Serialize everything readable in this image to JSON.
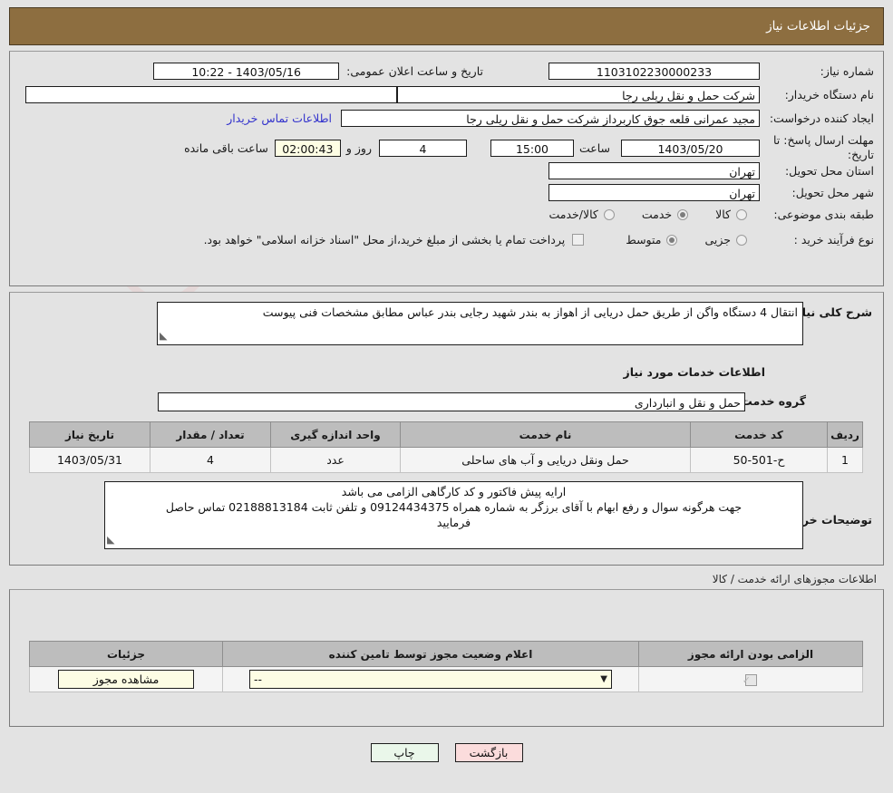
{
  "header": {
    "title": "جزئیات اطلاعات نیاز"
  },
  "top": {
    "need_number_label": "شماره نیاز:",
    "need_number_value": "1103102230000233",
    "public_announce_label": "تاریخ و ساعت اعلان عمومی:",
    "public_announce_value": "1403/05/16 - 10:22",
    "buyer_org_label": "نام دستگاه خریدار:",
    "buyer_org_value": "شرکت حمل و نقل ریلی رجا",
    "buyer_org_extra_value": "",
    "requester_label": "ایجاد کننده درخواست:",
    "requester_value": "مجید عمرانی قلعه جوق کاربرداز شرکت حمل و نقل ریلی رجا",
    "contact_link": "اطلاعات تماس خریدار",
    "deadline_label": "مهلت ارسال پاسخ: تا تاریخ:",
    "deadline_date": "1403/05/20",
    "hour_label": "ساعت",
    "deadline_time": "15:00",
    "days_value": "4",
    "days_label": "روز و",
    "countdown_value": "02:00:43",
    "remaining_label": "ساعت باقی مانده",
    "province_label": "استان محل تحویل:",
    "province_value": "تهران",
    "city_label": "شهر محل تحویل:",
    "city_value": "تهران",
    "category_label": "طبقه بندی موضوعی:",
    "category_options": [
      {
        "label": "کالا",
        "selected": false
      },
      {
        "label": "خدمت",
        "selected": true
      },
      {
        "label": "کالا/خدمت",
        "selected": false
      }
    ],
    "process_label": "نوع فرآیند خرید :",
    "process_options": [
      {
        "label": "جزیی",
        "selected": false
      },
      {
        "label": "متوسط",
        "selected": true
      }
    ],
    "treasury_checked": false,
    "treasury_text": "پرداخت تمام یا بخشی از مبلغ خرید،از محل \"اسناد خزانه اسلامی\" خواهد بود."
  },
  "body": {
    "general_desc_label": "شرح کلی نیاز:",
    "general_desc_value": "انتقال 4 دستگاه واگن از طریق حمل دریایی از اهواز به بندر شهید رجایی بندر عباس مطابق مشخصات فنی پیوست",
    "services_info_title": "اطلاعات خدمات مورد نیاز",
    "service_group_label": "گروه خدمت:",
    "service_group_value": "حمل و نقل و انبارداری",
    "services_table": {
      "headers": [
        "ردیف",
        "کد خدمت",
        "نام خدمت",
        "واحد اندازه گیری",
        "تعداد / مقدار",
        "تاریخ نیاز"
      ],
      "rows": [
        [
          "1",
          "ح-501-50",
          "حمل ونقل دریایی و آب های ساحلی",
          "عدد",
          "4",
          "1403/05/31"
        ]
      ]
    },
    "buyer_notes_label": "توضیحات خریدار:",
    "buyer_notes_lines": [
      "ارایه پیش فاکتور و کد کارگاهی الزامی می باشد",
      "جهت هرگونه سوال و رفع ابهام با آقای برزگر به شماره همراه 09124434375 و تلفن ثابت 02188813184 تماس حاصل",
      "فرمایید"
    ]
  },
  "permits": {
    "section_label": "اطلاعات مجوزهای ارائه خدمت / کالا",
    "table": {
      "headers": [
        "الزامی بودن ارائه مجوز",
        "اعلام وضعیت مجوز توسط تامین کننده",
        "جزئیات"
      ],
      "rows": [
        {
          "required_checked": true,
          "status_value": "--",
          "details_button": "مشاهده مجوز"
        }
      ]
    }
  },
  "footer": {
    "print_button": "چاپ",
    "back_button": "بازگشت"
  },
  "watermark": {
    "text": "AnaTender.net"
  },
  "colors": {
    "header_brown": "#8d6e40",
    "link_blue": "#3333cc",
    "cream": "#fdfde4",
    "pink": "#fbdcdc",
    "green": "#eaf7ea"
  }
}
